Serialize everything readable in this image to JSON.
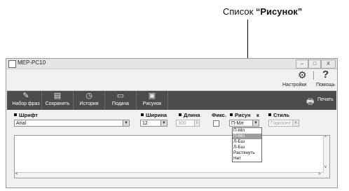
{
  "callout": {
    "prefix": "Список ",
    "bold": "“Рисунок”"
  },
  "window": {
    "title": "MEP-PC10",
    "minimize": "–",
    "maximize": "□",
    "close": "X"
  },
  "top_actions": {
    "settings_label": "Настройки",
    "help_label": "Помощь",
    "help_glyph": "?"
  },
  "toolbar": {
    "buttons": [
      {
        "label": "Набор фраз",
        "icon": "phrase-set-icon"
      },
      {
        "label": "Сохранить",
        "icon": "save-icon"
      },
      {
        "label": "История",
        "icon": "history-icon"
      },
      {
        "label": "Подача",
        "icon": "feed-icon"
      },
      {
        "label": "Рисунок",
        "icon": "picture-icon"
      }
    ],
    "print_label": "Печать"
  },
  "settings": {
    "font": {
      "label": "Шрифт",
      "value": "Arial"
    },
    "width": {
      "label": "Ширина",
      "value": "12"
    },
    "length": {
      "label": "Длина",
      "value": "300"
    },
    "fixed": {
      "label": "Фикс."
    },
    "picture": {
      "label": "Рисун",
      "label_tail": "к",
      "value": "П-Мл",
      "options": [
        "П-Мл",
        "П-Мл",
        "Л-Бш",
        "Л-Бш",
        "Растянуть",
        "Нет"
      ],
      "selected_index": 1
    },
    "style": {
      "label": "Стиль",
      "value": "Горизонт"
    }
  },
  "colors": {
    "toolbar_bg": "#4c4c4c",
    "selected_option": "#9e9e9e"
  }
}
